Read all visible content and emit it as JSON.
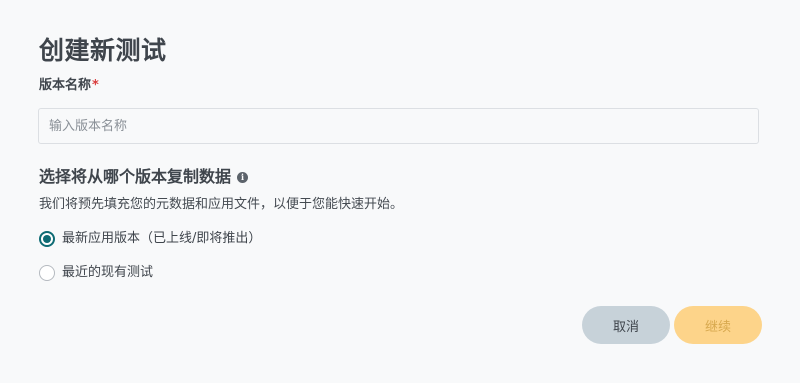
{
  "dialog": {
    "title": "创建新测试",
    "name_field": {
      "label": "版本名称",
      "required_mark": "*",
      "value": "",
      "placeholder": "输入版本名称"
    },
    "copy_section": {
      "heading": "选择将从哪个版本复制数据",
      "info_icon": "info-icon",
      "info_glyph": "i",
      "helper_text": "我们将预先填充您的元数据和应用文件，以便于您能快速开始。",
      "options": [
        {
          "label": "最新应用版本（已上线/即将推出）",
          "selected": true
        },
        {
          "label": "最近的现有测试",
          "selected": false
        }
      ]
    },
    "buttons": {
      "cancel_label": "取消",
      "continue_label": "继续",
      "continue_enabled": false
    }
  },
  "colors": {
    "accent": "#0e6b74",
    "required": "#d93c3c",
    "cancel_bg": "#c7d2d9",
    "continue_bg": "#fdd48a",
    "background": "#f8f9fa"
  }
}
